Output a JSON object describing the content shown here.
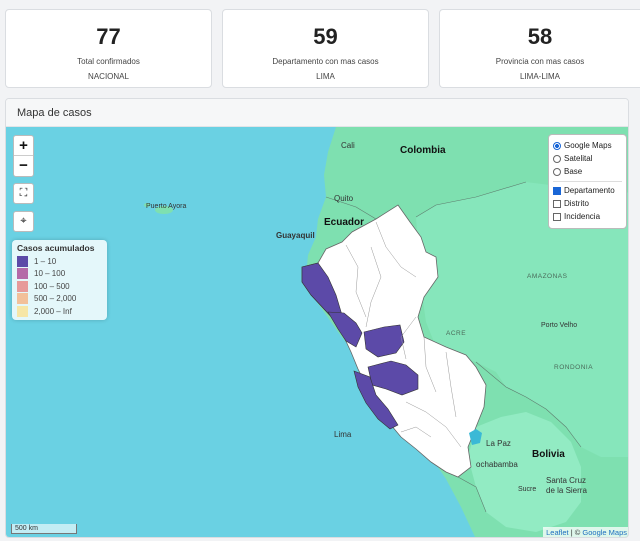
{
  "kpis": [
    {
      "value": "77",
      "label": "Total confirmados",
      "sub": "NACIONAL"
    },
    {
      "value": "59",
      "label": "Departamento con mas casos",
      "sub": "LIMA"
    },
    {
      "value": "58",
      "label": "Provincia con mas casos",
      "sub": "LIMA-LIMA"
    }
  ],
  "panel": {
    "title": "Mapa de casos"
  },
  "controls": {
    "zoom_in": "+",
    "zoom_out": "−"
  },
  "legend": {
    "title": "Casos acumulados",
    "items": [
      {
        "label": "1 – 10",
        "color": "#5c4aa8"
      },
      {
        "label": "10 – 100",
        "color": "#b46aa8"
      },
      {
        "label": "100 – 500",
        "color": "#e79a9a"
      },
      {
        "label": "500 – 2,000",
        "color": "#f2c09a"
      },
      {
        "label": "2,000 – Inf",
        "color": "#f6e6a6"
      }
    ]
  },
  "layers": {
    "base": [
      {
        "label": "Google Maps",
        "selected": true
      },
      {
        "label": "Satelital",
        "selected": false
      },
      {
        "label": "Base",
        "selected": false
      }
    ],
    "overlays": [
      {
        "label": "Departamento",
        "checked": true
      },
      {
        "label": "Distrito",
        "checked": false
      },
      {
        "label": "Incidencia",
        "checked": false
      }
    ]
  },
  "map_labels": {
    "colombia": "Colombia",
    "cali": "Cali",
    "quito": "Quito",
    "ecuador": "Ecuador",
    "guayaquil": "Guayaquil",
    "puerto_ayora": "Puerto Ayora",
    "amazonas": "AMAZONAS",
    "acre": "ACRE",
    "porto_velho": "Porto Velho",
    "rondonia": "RONDONIA",
    "lima": "Lima",
    "la_paz": "La Paz",
    "bolivia": "Bolivia",
    "cochabamba": "ochabamba",
    "santa_cruz_1": "Santa Cruz",
    "santa_cruz_2": "de la Sierra",
    "sucre": "Sucre"
  },
  "scale": "500 km",
  "attribution": {
    "leaflet": "Leaflet",
    "sep": " | © ",
    "google": "Google Maps"
  },
  "colors": {
    "ocean": "#6ad1e3",
    "land": "#7ee0b0",
    "peru": "#ffffff",
    "highlight": "#5c4aa8"
  }
}
